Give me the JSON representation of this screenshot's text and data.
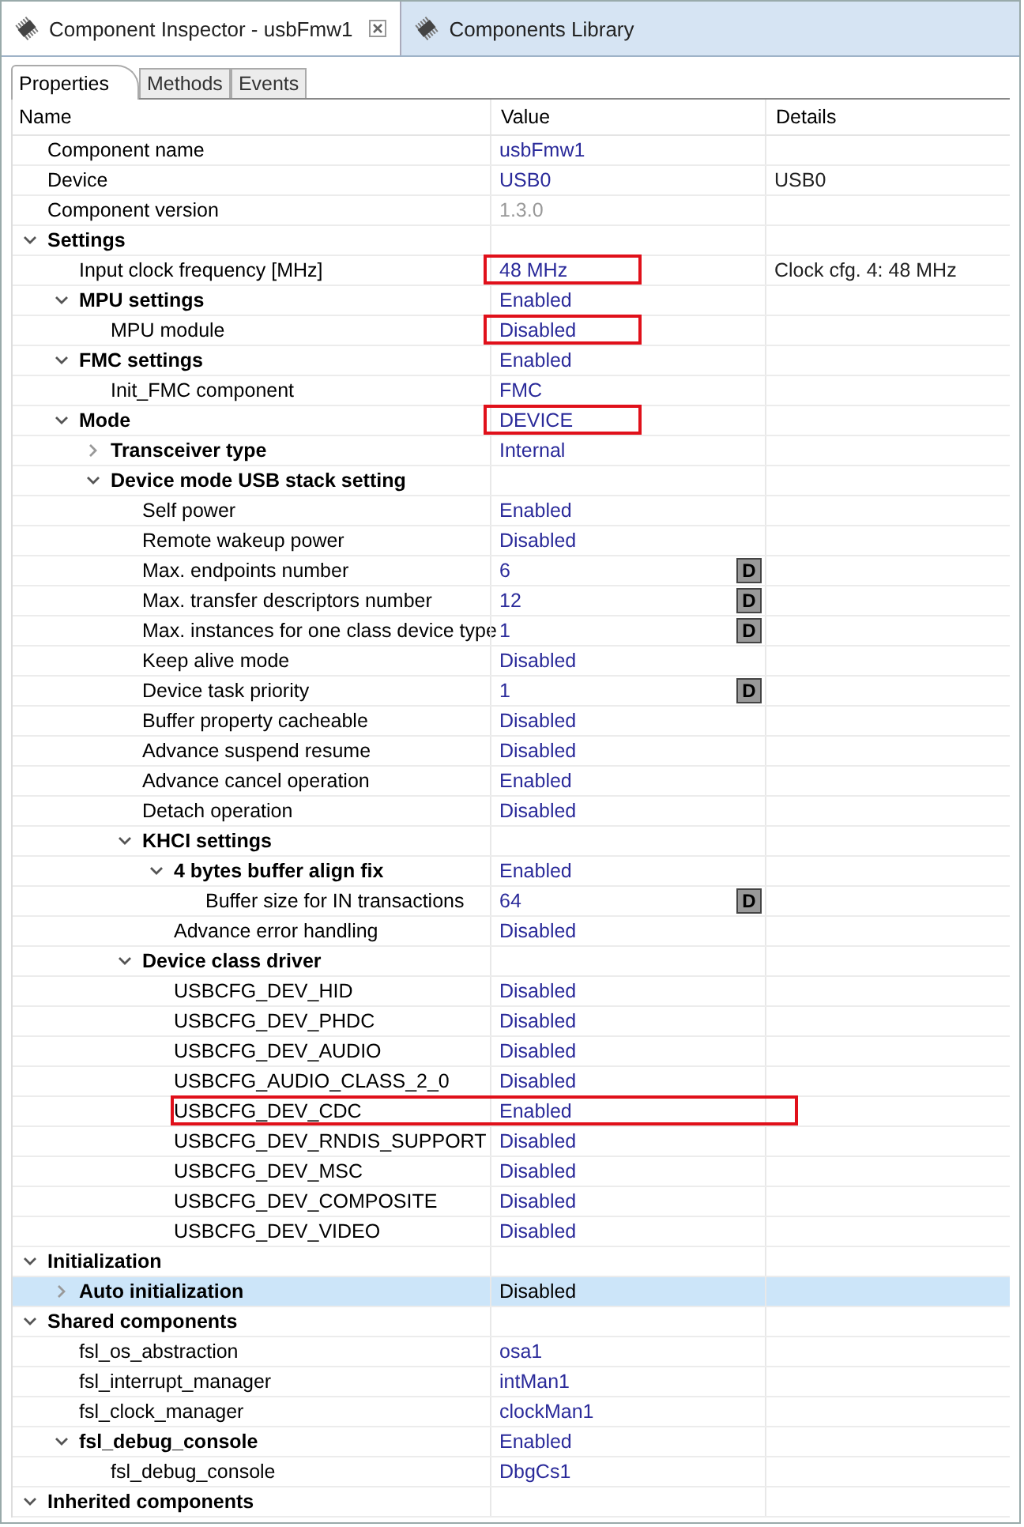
{
  "editor_tabs": [
    {
      "label": "Component Inspector - usbFmw1",
      "selected": true,
      "closable": true
    },
    {
      "label": "Components Library",
      "selected": false,
      "closable": false
    }
  ],
  "view_tabs": [
    {
      "label": "Properties",
      "selected": true
    },
    {
      "label": "Methods",
      "selected": false
    },
    {
      "label": "Events",
      "selected": false
    }
  ],
  "columns": [
    "Name",
    "Value",
    "Details"
  ],
  "rows": [
    {
      "name": "Component name",
      "value": "usbFmw1",
      "kind": "property",
      "selected": false
    },
    {
      "name": "Device",
      "value": "USB0",
      "details": "USB0",
      "kind": "property",
      "selected": false
    },
    {
      "name": "Component version",
      "value": "1.3.0",
      "kind": "info",
      "selected": false
    },
    {
      "name": "Settings",
      "kind": "group",
      "expanded": true,
      "selected": false,
      "children": [
        {
          "name": "Input clock frequency [MHz]",
          "value": "48 MHz",
          "details": "Clock cfg. 4: 48 MHz",
          "kind": "property",
          "selected": false,
          "value_boxed": true
        },
        {
          "name": "MPU settings",
          "value": "Enabled",
          "kind": "group",
          "expanded": true,
          "selected": false,
          "children": [
            {
              "name": "MPU module",
              "value": "Disabled",
              "kind": "property",
              "selected": false,
              "value_boxed": true
            }
          ]
        },
        {
          "name": "FMC settings",
          "value": "Enabled",
          "kind": "group",
          "expanded": true,
          "selected": false,
          "children": [
            {
              "name": "Init_FMC component",
              "value": "FMC",
              "kind": "property",
              "selected": false
            }
          ]
        },
        {
          "name": "Mode",
          "value": "DEVICE",
          "kind": "group",
          "expanded": true,
          "selected": false,
          "value_boxed": true,
          "children": [
            {
              "name": "Transceiver type",
              "value": "Internal",
              "kind": "group",
              "expanded": false,
              "selected": false
            },
            {
              "name": "Device mode USB stack setting",
              "kind": "group",
              "expanded": true,
              "selected": false,
              "children": [
                {
                  "name": "Self power",
                  "value": "Enabled",
                  "kind": "property",
                  "selected": false
                },
                {
                  "name": "Remote wakeup power",
                  "value": "Disabled",
                  "kind": "property",
                  "selected": false
                },
                {
                  "name": "Max. endpoints number",
                  "value": "6",
                  "default_button": "D",
                  "kind": "property",
                  "selected": false
                },
                {
                  "name": "Max. transfer descriptors number",
                  "value": "12",
                  "default_button": "D",
                  "kind": "property",
                  "selected": false
                },
                {
                  "name": "Max. instances for one class device type",
                  "value": "1",
                  "default_button": "D",
                  "kind": "property",
                  "selected": false
                },
                {
                  "name": "Keep alive mode",
                  "value": "Disabled",
                  "kind": "property",
                  "selected": false
                },
                {
                  "name": "Device task priority",
                  "value": "1",
                  "default_button": "D",
                  "kind": "property",
                  "selected": false
                },
                {
                  "name": "Buffer property cacheable",
                  "value": "Disabled",
                  "kind": "property",
                  "selected": false
                },
                {
                  "name": "Advance suspend resume",
                  "value": "Disabled",
                  "kind": "property",
                  "selected": false
                },
                {
                  "name": "Advance cancel operation",
                  "value": "Enabled",
                  "kind": "property",
                  "selected": false
                },
                {
                  "name": "Detach operation",
                  "value": "Disabled",
                  "kind": "property",
                  "selected": false
                },
                {
                  "name": "KHCI settings",
                  "kind": "group",
                  "expanded": true,
                  "selected": false,
                  "children": [
                    {
                      "name": "4 bytes buffer align fix",
                      "value": "Enabled",
                      "kind": "group",
                      "expanded": true,
                      "selected": false,
                      "children": [
                        {
                          "name": "Buffer size for IN transactions",
                          "value": "64",
                          "default_button": "D",
                          "kind": "property",
                          "selected": false
                        }
                      ]
                    },
                    {
                      "name": "Advance error handling",
                      "value": "Disabled",
                      "kind": "property",
                      "selected": false
                    }
                  ]
                },
                {
                  "name": "Device class driver",
                  "kind": "group",
                  "expanded": true,
                  "selected": false,
                  "children": [
                    {
                      "name": "USBCFG_DEV_HID",
                      "value": "Disabled",
                      "kind": "property",
                      "selected": false
                    },
                    {
                      "name": "USBCFG_DEV_PHDC",
                      "value": "Disabled",
                      "kind": "property",
                      "selected": false
                    },
                    {
                      "name": "USBCFG_DEV_AUDIO",
                      "value": "Disabled",
                      "kind": "property",
                      "selected": false
                    },
                    {
                      "name": "USBCFG_AUDIO_CLASS_2_0",
                      "value": "Disabled",
                      "kind": "property",
                      "selected": false
                    },
                    {
                      "name": "USBCFG_DEV_CDC",
                      "value": "Enabled",
                      "kind": "property",
                      "selected": false,
                      "row_boxed": true
                    },
                    {
                      "name": "USBCFG_DEV_RNDIS_SUPPORT",
                      "value": "Disabled",
                      "kind": "property",
                      "selected": false
                    },
                    {
                      "name": "USBCFG_DEV_MSC",
                      "value": "Disabled",
                      "kind": "property",
                      "selected": false
                    },
                    {
                      "name": "USBCFG_DEV_COMPOSITE",
                      "value": "Disabled",
                      "kind": "property",
                      "selected": false
                    },
                    {
                      "name": "USBCFG_DEV_VIDEO",
                      "value": "Disabled",
                      "kind": "property",
                      "selected": false
                    }
                  ]
                }
              ]
            }
          ]
        }
      ]
    },
    {
      "name": "Initialization",
      "kind": "group",
      "expanded": true,
      "selected": false,
      "children": [
        {
          "name": "Auto initialization",
          "value": "Disabled",
          "kind": "group",
          "expanded": false,
          "selected": true
        }
      ]
    },
    {
      "name": "Shared components",
      "kind": "group",
      "expanded": true,
      "selected": false,
      "children": [
        {
          "name": "fsl_os_abstraction",
          "value": "osa1",
          "kind": "property",
          "selected": false
        },
        {
          "name": "fsl_interrupt_manager",
          "value": "intMan1",
          "kind": "property",
          "selected": false
        },
        {
          "name": "fsl_clock_manager",
          "value": "clockMan1",
          "kind": "property",
          "selected": false
        },
        {
          "name": "fsl_debug_console",
          "value": "Enabled",
          "kind": "group",
          "expanded": true,
          "selected": false,
          "children": [
            {
              "name": "fsl_debug_console",
              "value": "DbgCs1",
              "kind": "property",
              "selected": false
            }
          ]
        }
      ]
    },
    {
      "name": "Inherited components",
      "kind": "group",
      "expanded": true,
      "selected": false
    }
  ]
}
